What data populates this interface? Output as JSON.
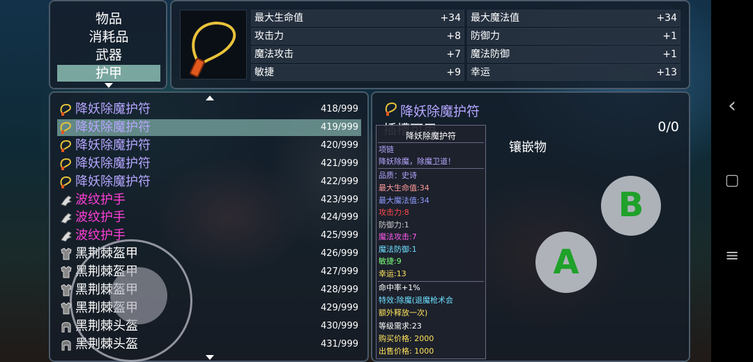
{
  "categories": {
    "items": [
      "物品",
      "消耗品",
      "武器",
      "护甲"
    ],
    "selected_index": 3
  },
  "stats": [
    {
      "name": "最大生命值",
      "value": "+34"
    },
    {
      "name": "最大魔法值",
      "value": "+34"
    },
    {
      "name": "攻击力",
      "value": "+8"
    },
    {
      "name": "防御力",
      "value": "+1"
    },
    {
      "name": "魔法攻击",
      "value": "+7"
    },
    {
      "name": "魔法防御",
      "value": "+1"
    },
    {
      "name": "敏捷",
      "value": "+9"
    },
    {
      "name": "幸运",
      "value": "+13"
    }
  ],
  "inventory": {
    "selected_index": 1,
    "rows": [
      {
        "name": "降妖除魔护符",
        "count": "418/999",
        "color": "#b6a6ff",
        "icon": "amulet-icon"
      },
      {
        "name": "降妖除魔护符",
        "count": "419/999",
        "color": "#b6a6ff",
        "icon": "amulet-icon"
      },
      {
        "name": "降妖除魔护符",
        "count": "420/999",
        "color": "#b6a6ff",
        "icon": "amulet-icon"
      },
      {
        "name": "降妖除魔护符",
        "count": "421/999",
        "color": "#b6a6ff",
        "icon": "amulet-icon"
      },
      {
        "name": "降妖除魔护符",
        "count": "422/999",
        "color": "#b6a6ff",
        "icon": "amulet-icon"
      },
      {
        "name": "波纹护手",
        "count": "423/999",
        "color": "#ff3fd8",
        "icon": "gauntlet-icon"
      },
      {
        "name": "波纹护手",
        "count": "424/999",
        "color": "#ff3fd8",
        "icon": "gauntlet-icon"
      },
      {
        "name": "波纹护手",
        "count": "425/999",
        "color": "#ff3fd8",
        "icon": "gauntlet-icon"
      },
      {
        "name": "黑荆棘盔甲",
        "count": "426/999",
        "color": "#ffffff",
        "icon": "armor-icon"
      },
      {
        "name": "黑荆棘盔甲",
        "count": "427/999",
        "color": "#ffffff",
        "icon": "armor-icon"
      },
      {
        "name": "黑荆棘盔甲",
        "count": "428/999",
        "color": "#ffffff",
        "icon": "armor-icon"
      },
      {
        "name": "黑荆棘盔甲",
        "count": "429/999",
        "color": "#ffffff",
        "icon": "armor-icon"
      },
      {
        "name": "黑荆棘头盔",
        "count": "430/999",
        "color": "#ffffff",
        "icon": "helmet-icon"
      },
      {
        "name": "黑荆棘头盔",
        "count": "431/999",
        "color": "#ffffff",
        "icon": "helmet-icon"
      }
    ]
  },
  "detail": {
    "item_name": "降妖除魔护符",
    "slots_label": "插槽可用",
    "slots_count": "0/0",
    "socket_label": "镶嵌物"
  },
  "tooltip": {
    "title": "降妖除魔护符",
    "type": "项链",
    "description": "降妖除魔，除魔卫道！",
    "quality": "品质：史诗",
    "stats": [
      {
        "text": "最大生命值:34",
        "color": "#ff9c9c"
      },
      {
        "text": "最大魔法值:34",
        "color": "#8f9cff"
      },
      {
        "text": "攻击力:8",
        "color": "#ff4a4a"
      },
      {
        "text": "防御力:1",
        "color": "#c8c8c8"
      },
      {
        "text": "魔法攻击:7",
        "color": "#ff5cf0"
      },
      {
        "text": "魔法防御:1",
        "color": "#6ee0ff"
      },
      {
        "text": "敏捷:9",
        "color": "#7aff7a"
      },
      {
        "text": "幸运:13",
        "color": "#ffe45c"
      }
    ],
    "hit_rate": "命中率+1%",
    "effect_line1": "特效:除魔(退魔枪术会",
    "effect_line2": "额外释放一次)",
    "level_req": "等级需求:23",
    "buy_price": "购买价格:  2000",
    "sell_price": "出售价格:  1000"
  },
  "buttons": {
    "a_label": "A",
    "b_label": "B"
  },
  "navbar": {
    "back": "‹",
    "home": "▢",
    "menu": "≡"
  }
}
